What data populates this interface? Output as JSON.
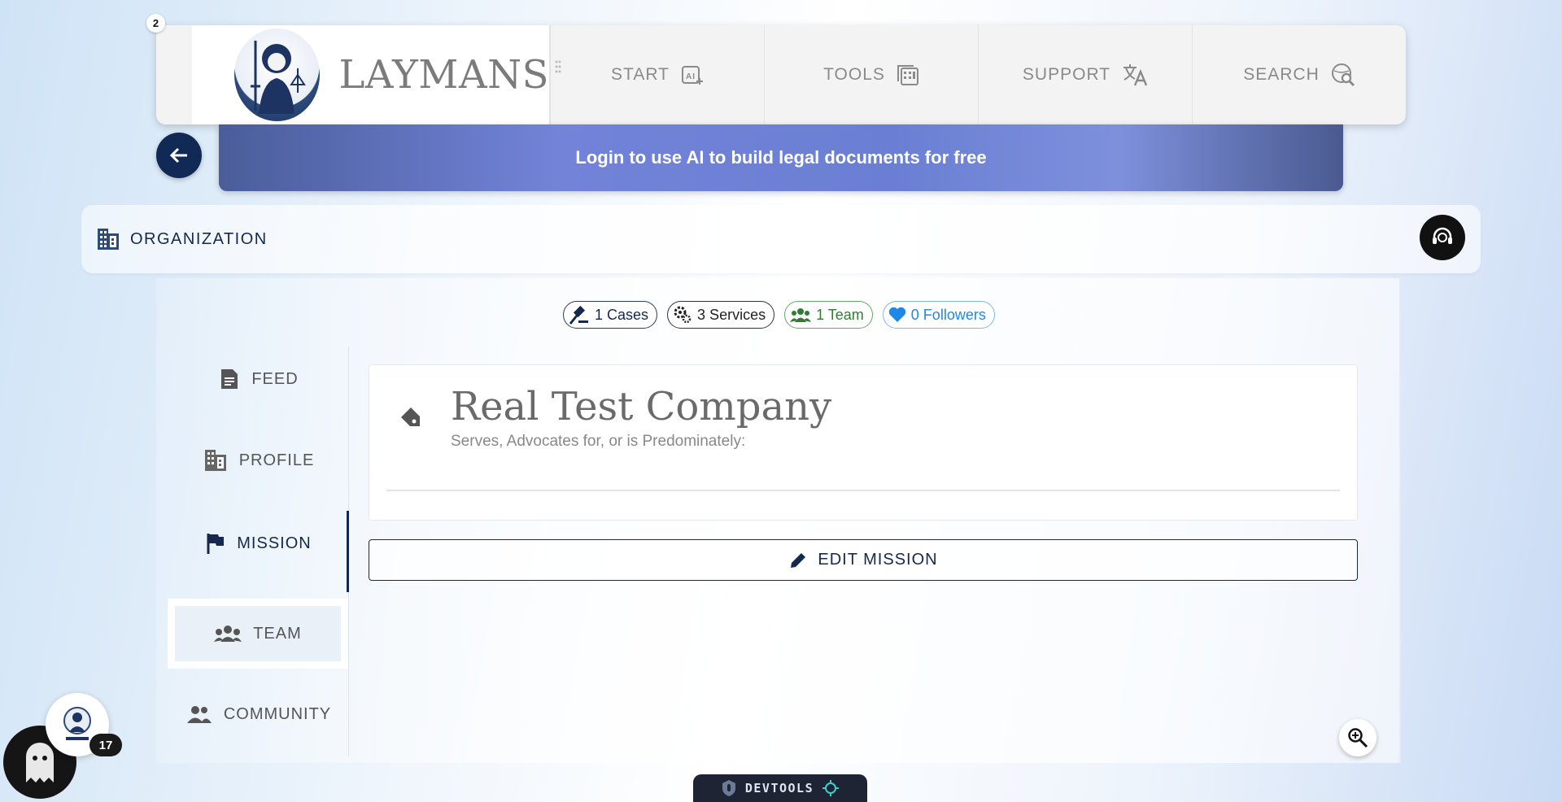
{
  "nav": {
    "badge_count": "2",
    "brand": "LAYMANS",
    "items": [
      {
        "label": "START",
        "icon": "ai-sparkle-icon"
      },
      {
        "label": "TOOLS",
        "icon": "calculator-icon"
      },
      {
        "label": "SUPPORT",
        "icon": "translate-icon"
      },
      {
        "label": "SEARCH",
        "icon": "search-globe-icon"
      }
    ]
  },
  "banner": {
    "text": "Login to use AI to build legal documents for free"
  },
  "header": {
    "label": "ORGANIZATION"
  },
  "stats": {
    "cases": "1 Cases",
    "services": "3 Services",
    "team": "1 Team",
    "followers": "0 Followers"
  },
  "sidebar": {
    "items": [
      {
        "label": "FEED"
      },
      {
        "label": "PROFILE"
      },
      {
        "label": "MISSION"
      },
      {
        "label": "TEAM"
      },
      {
        "label": "COMMUNITY"
      }
    ],
    "active": "MISSION"
  },
  "mission": {
    "company_name": "Real Test Company",
    "subtitle": "Serves, Advocates for, or is Predominately:",
    "edit_label": "EDIT MISSION"
  },
  "widgets": {
    "notification_count": "17",
    "devtools_label": "DEVTOOLS"
  },
  "colors": {
    "primary": "#14294d",
    "banner": "#7283d8",
    "team_green": "#2e7d32",
    "followers_blue": "#1e88e5"
  }
}
